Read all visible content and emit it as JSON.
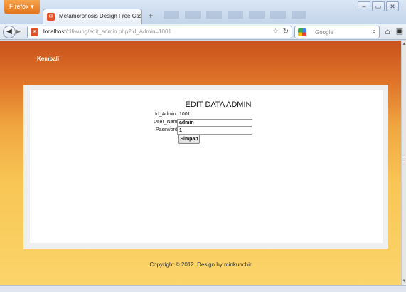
{
  "browser": {
    "menu_label": "Firefox ▾",
    "tab_title": "Metamorphosis Design Free Css Templa...",
    "new_tab": "+",
    "url_host": "localhost",
    "url_path": "/ciliwung/edit_admin.php?Id_Admin=1001",
    "search_placeholder": "Google",
    "window_controls": [
      "–",
      "▭",
      "✕"
    ]
  },
  "page": {
    "back_link": "Kembali",
    "form": {
      "title": "EDIT DATA ADMIN",
      "id_label": "Id_Admin:",
      "id_value": "1001",
      "username_label": "User_Name:",
      "username_value": "admin",
      "password_label": "Password:",
      "password_value": "1",
      "submit_label": "Simpan"
    },
    "footer": "Copyright © 2012. Design by minkunchir"
  },
  "colors": {
    "header_top": "#c9521b",
    "page_bottom": "#fbd46a",
    "content_bg": "#ffffff"
  }
}
